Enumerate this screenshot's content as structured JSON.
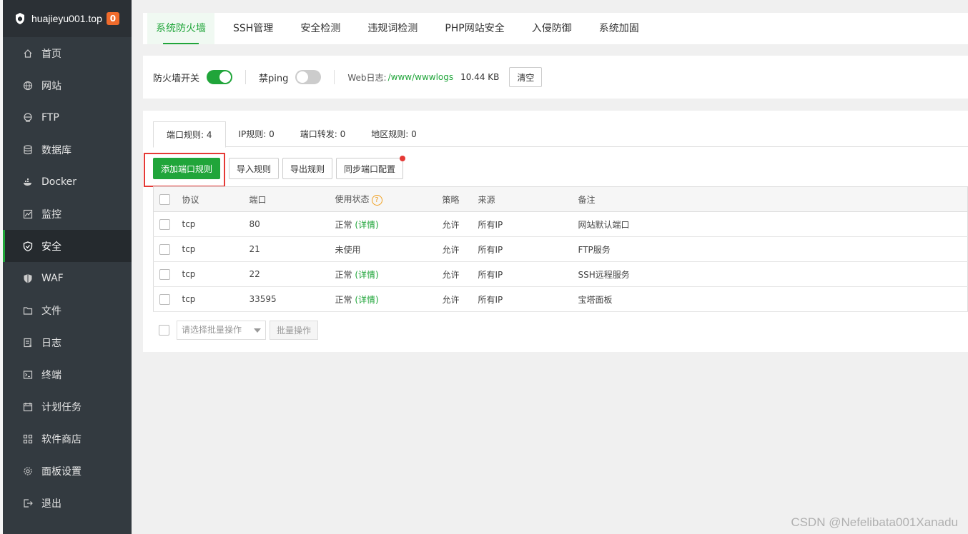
{
  "app": {
    "host": "huajieyu001.top",
    "badge": "0"
  },
  "sidebar": {
    "items": [
      {
        "label": "首页",
        "icon": "home-icon"
      },
      {
        "label": "网站",
        "icon": "globe-icon"
      },
      {
        "label": "FTP",
        "icon": "ftp-icon"
      },
      {
        "label": "数据库",
        "icon": "database-icon"
      },
      {
        "label": "Docker",
        "icon": "docker-icon"
      },
      {
        "label": "监控",
        "icon": "monitor-icon"
      },
      {
        "label": "安全",
        "icon": "shield-icon",
        "active": true
      },
      {
        "label": "WAF",
        "icon": "waf-shield-icon"
      },
      {
        "label": "文件",
        "icon": "folder-icon"
      },
      {
        "label": "日志",
        "icon": "log-icon"
      },
      {
        "label": "终端",
        "icon": "terminal-icon"
      },
      {
        "label": "计划任务",
        "icon": "calendar-icon"
      },
      {
        "label": "软件商店",
        "icon": "apps-icon"
      },
      {
        "label": "面板设置",
        "icon": "gear-icon"
      },
      {
        "label": "退出",
        "icon": "logout-icon"
      }
    ]
  },
  "topnav": {
    "tabs": [
      {
        "label": "系统防火墙",
        "active": true
      },
      {
        "label": "SSH管理"
      },
      {
        "label": "安全检测"
      },
      {
        "label": "违规词检测"
      },
      {
        "label": "PHP网站安全"
      },
      {
        "label": "入侵防御"
      },
      {
        "label": "系统加固"
      }
    ]
  },
  "switches": {
    "firewall_label": "防火墙开关",
    "firewall_on": true,
    "ping_label": "禁ping",
    "ping_on": false,
    "weblog_label": "Web日志:",
    "weblog_path": "/www/wwwlogs",
    "weblog_size": "10.44 KB",
    "clear_label": "清空"
  },
  "subtabs": [
    {
      "label": "端口规则: 4",
      "active": true
    },
    {
      "label": "IP规则: 0"
    },
    {
      "label": "端口转发: 0"
    },
    {
      "label": "地区规则: 0"
    }
  ],
  "actions": {
    "add_label": "添加端口规则",
    "import_label": "导入规则",
    "export_label": "导出规则",
    "sync_label": "同步端口配置"
  },
  "table": {
    "headers": {
      "protocol": "协议",
      "port": "端口",
      "status": "使用状态",
      "policy": "策略",
      "source": "来源",
      "remark": "备注"
    },
    "rows": [
      {
        "protocol": "tcp",
        "port": "80",
        "status": "正常",
        "detail": "(详情)",
        "policy": "允许",
        "source": "所有IP",
        "remark": "网站默认端口"
      },
      {
        "protocol": "tcp",
        "port": "21",
        "status": "未使用",
        "detail": "",
        "policy": "允许",
        "source": "所有IP",
        "remark": "FTP服务"
      },
      {
        "protocol": "tcp",
        "port": "22",
        "status": "正常",
        "detail": "(详情)",
        "policy": "允许",
        "source": "所有IP",
        "remark": "SSH远程服务"
      },
      {
        "protocol": "tcp",
        "port": "33595",
        "status": "正常",
        "detail": "(详情)",
        "policy": "允许",
        "source": "所有IP",
        "remark": "宝塔面板"
      }
    ]
  },
  "batch": {
    "select_placeholder": "请选择批量操作",
    "button_label": "批量操作"
  },
  "watermark": "CSDN @Nefelibata001Xanadu",
  "colors": {
    "accent": "#20a53a",
    "sidebar_bg": "#333a40",
    "highlight": "#e53935"
  }
}
